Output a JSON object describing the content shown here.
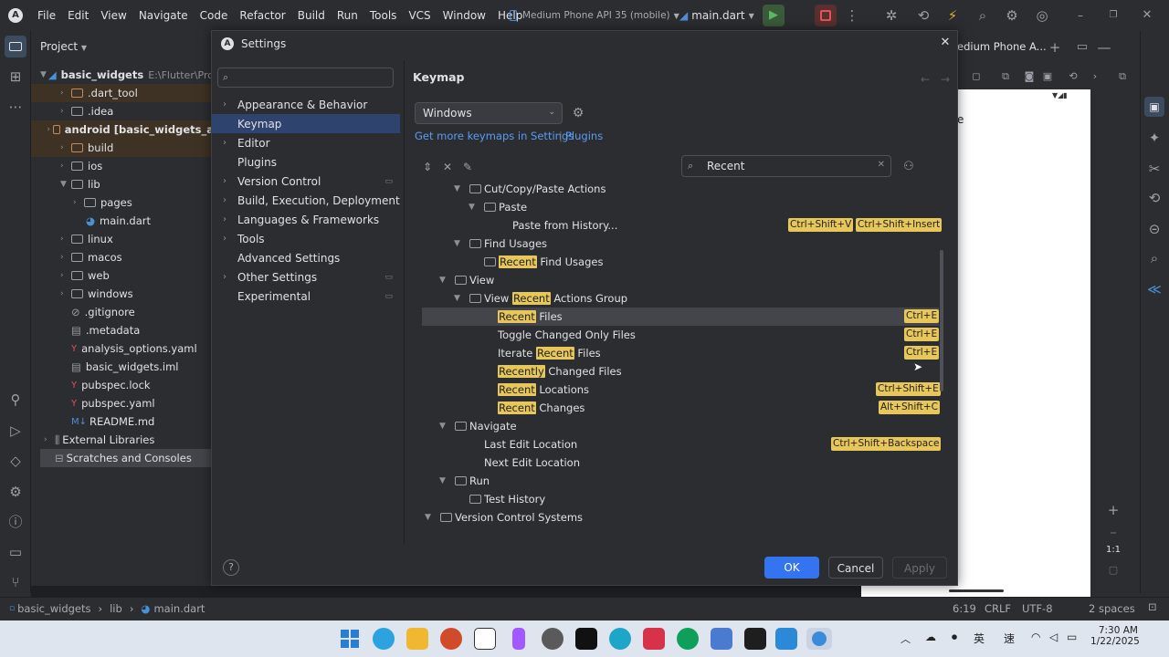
{
  "menu": [
    "File",
    "Edit",
    "View",
    "Navigate",
    "Code",
    "Refactor",
    "Build",
    "Run",
    "Tools",
    "VCS",
    "Window",
    "Help"
  ],
  "toolbar": {
    "device": "Medium Phone API 35 (mobile)",
    "file": "main.dart"
  },
  "project": {
    "title": "Project",
    "root": "basic_widgets",
    "root_path": "E:\\Flutter\\Pro",
    "items": [
      ".dart_tool",
      ".idea",
      "android [basic_widgets_a",
      "build",
      "ios",
      "lib",
      "pages",
      "main.dart",
      "linux",
      "macos",
      "web",
      "windows",
      ".gitignore",
      ".metadata",
      "analysis_options.yaml",
      "basic_widgets.iml",
      "pubspec.lock",
      "pubspec.yaml",
      "README.md",
      "External Libraries",
      "Scratches and Consoles"
    ]
  },
  "right": {
    "tab": "edium Phone A...",
    "phone_text": "e",
    "zoom": "1:1"
  },
  "dialog": {
    "title": "Settings",
    "search_placeholder": "",
    "nav": [
      "Appearance & Behavior",
      "Keymap",
      "Editor",
      "Plugins",
      "Version Control",
      "Build, Execution, Deployment",
      "Languages & Frameworks",
      "Tools",
      "Advanced Settings",
      "Other Settings",
      "Experimental"
    ],
    "heading": "Keymap",
    "keymap_select": "Windows",
    "link1": "Get more keymaps in Settings",
    "link_sep": "|",
    "link2": "Plugins",
    "search_value": "Recent",
    "ok": "OK",
    "cancel": "Cancel",
    "apply": "Apply",
    "help": "?"
  },
  "tree": [
    {
      "l1": "Cut/Copy/Paste Actions"
    },
    {
      "l1": "Paste"
    },
    {
      "l1": "Paste from History...",
      "s1": "Ctrl+Shift+V",
      "s2": "Ctrl+Shift+Insert"
    },
    {
      "l1": "Find Usages"
    },
    {
      "m": "Recent",
      "l2": " Find Usages"
    },
    {
      "l1": "View"
    },
    {
      "l1": "View ",
      "m": "Recent",
      "l2": " Actions Group"
    },
    {
      "m": "Recent",
      "l2": " Files",
      "s2": "Ctrl+E"
    },
    {
      "l1": "Toggle Changed Only Files",
      "s2": "Ctrl+E"
    },
    {
      "l1": "Iterate ",
      "m": "Recent",
      "l2": " Files",
      "s2": "Ctrl+E"
    },
    {
      "m": "Recently",
      "l2": " Changed Files"
    },
    {
      "m": "Recent",
      "l2": " Locations",
      "s2": "Ctrl+Shift+E"
    },
    {
      "m": "Recent",
      "l2": " Changes",
      "s2": "Alt+Shift+C"
    },
    {
      "l1": "Navigate"
    },
    {
      "l1": "Last Edit Location",
      "s2": "Ctrl+Shift+Backspace"
    },
    {
      "l1": "Next Edit Location"
    },
    {
      "l1": "Run"
    },
    {
      "l1": "Test History"
    },
    {
      "l1": "Version Control Systems"
    }
  ],
  "status": {
    "crumb1": "basic_widgets",
    "crumb2": "lib",
    "crumb3": "main.dart",
    "pos": "6:19",
    "eol": "CRLF",
    "enc": "UTF-8",
    "indent": "2 spaces"
  },
  "taskbar": {
    "ime1": "英",
    "ime2": "速",
    "time": "7:30 AM",
    "date": "1/22/2025"
  }
}
